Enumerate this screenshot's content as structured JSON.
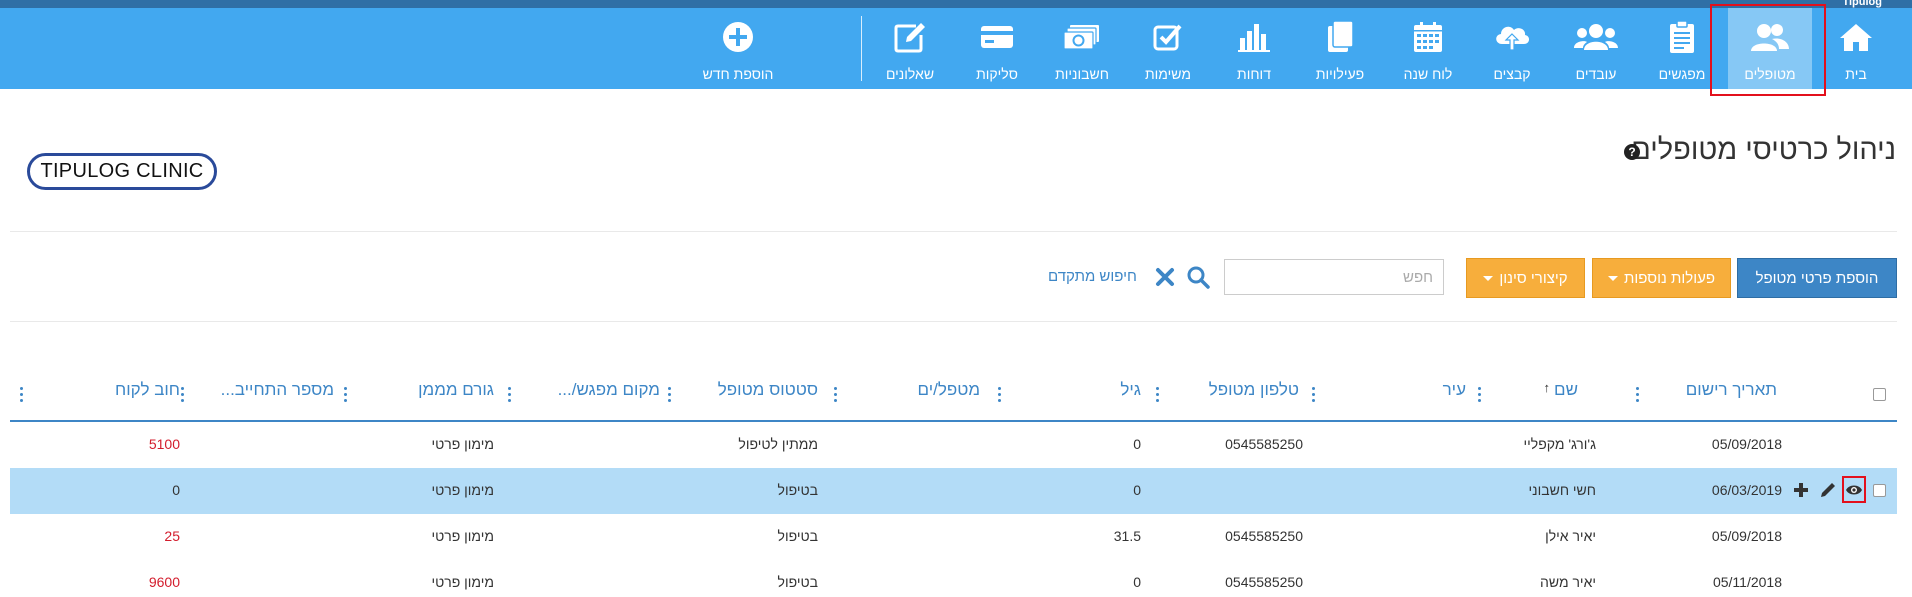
{
  "app": {
    "brand": "Tipulog"
  },
  "nav": {
    "items": [
      {
        "key": "home",
        "label": "בית",
        "icon": "house-icon"
      },
      {
        "key": "patients",
        "label": "מטופלים",
        "icon": "users-icon",
        "active": true
      },
      {
        "key": "meetings",
        "label": "מפגשים",
        "icon": "clipboard-icon"
      },
      {
        "key": "employees",
        "label": "עובדים",
        "icon": "group-icon"
      },
      {
        "key": "files",
        "label": "קבצים",
        "icon": "cloud-upload-icon"
      },
      {
        "key": "calendar",
        "label": "לוח שנה",
        "icon": "calendar-icon"
      },
      {
        "key": "activities",
        "label": "פעילויות",
        "icon": "copy-icon"
      },
      {
        "key": "reports",
        "label": "דוחות",
        "icon": "bar-chart-icon"
      },
      {
        "key": "tasks",
        "label": "משימות",
        "icon": "check-square-icon"
      },
      {
        "key": "invoices",
        "label": "חשבוניות",
        "icon": "money-icon"
      },
      {
        "key": "clearing",
        "label": "סליקות",
        "icon": "credit-card-icon"
      },
      {
        "key": "questionnaires",
        "label": "שאלונים",
        "icon": "edit-icon"
      }
    ],
    "add_new": {
      "label": "הוספת חדש",
      "icon": "plus-circle-icon"
    }
  },
  "page": {
    "title": "ניהול כרטיסי מטופלים",
    "logo_text": "TIPULOG CLINIC"
  },
  "toolbar": {
    "add_patient": "הוספת פרטי מטופל",
    "more_actions": "פעולות נוספות",
    "filter_shortcuts": "קיצורי סינון",
    "search_placeholder": "חפש",
    "search_value": "",
    "advanced_search": "חיפוש מתקדם"
  },
  "table": {
    "columns": [
      {
        "key": "reg_date",
        "label": "תאריך רישום"
      },
      {
        "key": "name",
        "label": "שם",
        "sorted": "asc"
      },
      {
        "key": "city",
        "label": "עיר"
      },
      {
        "key": "phone",
        "label": "טלפון מטופל"
      },
      {
        "key": "age",
        "label": "גיל"
      },
      {
        "key": "therapists",
        "label": "מטפל/ים"
      },
      {
        "key": "status",
        "label": "סטטוס מטופל"
      },
      {
        "key": "location",
        "label": "מקום מפגש/..."
      },
      {
        "key": "funder",
        "label": "גורם מממן"
      },
      {
        "key": "commitment",
        "label": "מספר התחייב..."
      },
      {
        "key": "debt",
        "label": "חוב לקוח"
      }
    ],
    "rows": [
      {
        "reg_date": "05/09/2018",
        "name": "ג'ורג' מקפליי",
        "city": "",
        "phone": "0545585250",
        "age": "0",
        "therapists": "",
        "status": "ממתין לטיפול",
        "location": "",
        "funder": "מימון פרטי",
        "commitment": "",
        "debt": "5100",
        "debt_red": true
      },
      {
        "reg_date": "06/03/2019",
        "name": "חשי חשבוני",
        "city": "",
        "phone": "",
        "age": "0",
        "therapists": "",
        "status": "בטיפול",
        "location": "",
        "funder": "מימון פרטי",
        "commitment": "",
        "debt": "0",
        "debt_red": false,
        "selected": true
      },
      {
        "reg_date": "05/09/2018",
        "name": "יאיר אילן",
        "city": "",
        "phone": "0545585250",
        "age": "31.5",
        "therapists": "",
        "status": "בטיפול",
        "location": "",
        "funder": "מימון פרטי",
        "commitment": "",
        "debt": "25",
        "debt_red": true
      },
      {
        "reg_date": "05/11/2018",
        "name": "יאיר משה",
        "city": "",
        "phone": "0545585250",
        "age": "0",
        "therapists": "",
        "status": "בטיפול",
        "location": "",
        "funder": "מימון פרטי",
        "commitment": "",
        "debt": "9600",
        "debt_red": true
      }
    ]
  },
  "colors": {
    "nav_bg": "#42a8f0",
    "nav_active": "#86c8f5",
    "accent": "#3d86c6",
    "orange": "#f7ae3c",
    "debt_red": "#d31d2d",
    "selected_row": "#b3dcf7"
  }
}
